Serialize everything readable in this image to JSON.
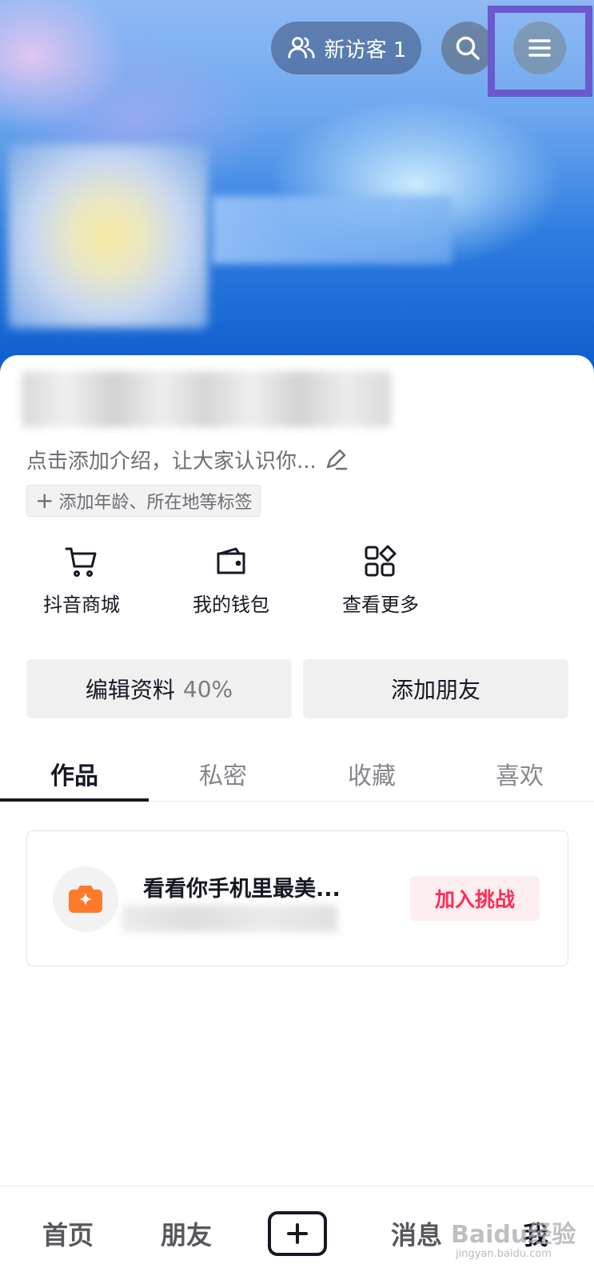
{
  "header": {
    "visitors_label": "新访客 1"
  },
  "profile": {
    "bio_placeholder": "点击添加介绍，让大家认识你...",
    "tag_hint": "添加年龄、所在地等标签"
  },
  "shortcuts": [
    {
      "label": "抖音商城",
      "icon": "cart-icon"
    },
    {
      "label": "我的钱包",
      "icon": "wallet-icon"
    },
    {
      "label": "查看更多",
      "icon": "grid-more-icon"
    }
  ],
  "actions": {
    "edit_profile_label": "编辑资料",
    "edit_profile_progress": "40%",
    "add_friends_label": "添加朋友"
  },
  "tabs": [
    {
      "label": "作品",
      "active": true
    },
    {
      "label": "私密",
      "active": false
    },
    {
      "label": "收藏",
      "active": false
    },
    {
      "label": "喜欢",
      "active": false
    }
  ],
  "challenge": {
    "title": "看看你手机里最美...",
    "join_label": "加入挑战"
  },
  "bottom_nav": {
    "home": "首页",
    "friends": "朋友",
    "messages": "消息",
    "me": "我"
  },
  "watermark": {
    "main": "Baidu经验",
    "sub": "jingyan.baidu.com"
  },
  "colors": {
    "accent_red": "#fe2c55",
    "highlight_box": "#6a5acd",
    "challenge_orange": "#ff7a2a"
  }
}
